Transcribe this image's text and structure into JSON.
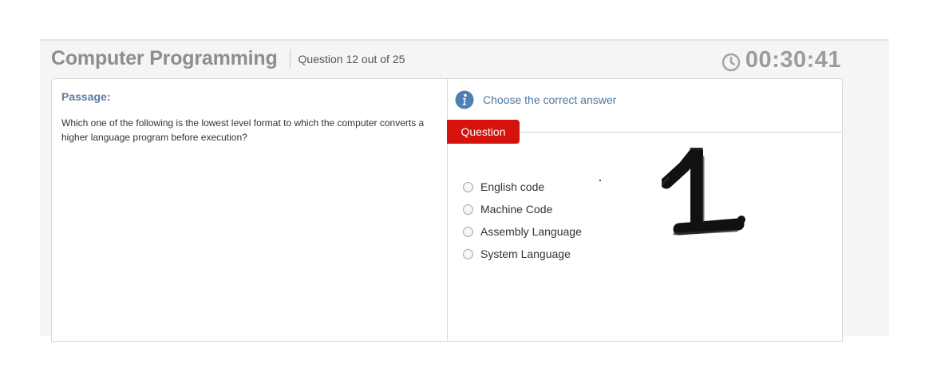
{
  "header": {
    "title": "Computer Programming",
    "question_counter": "Question 12 out of 25",
    "timer": "00:30:41",
    "timer_icon": "clock-icon"
  },
  "passage": {
    "label": "Passage:",
    "text": "Which one of the following is the lowest level format to which the computer converts a higher language program before execution?"
  },
  "question": {
    "instruction": "Choose the correct answer",
    "instruction_icon": "info-icon",
    "tab_label": "Question",
    "options": [
      {
        "label": "English code",
        "selected": false
      },
      {
        "label": "Machine Code",
        "selected": false
      },
      {
        "label": "Assembly Language",
        "selected": false
      },
      {
        "label": "System Language",
        "selected": false
      }
    ],
    "handwritten_mark": "1"
  },
  "colors": {
    "title_gray": "#8c8e91",
    "accent_blue": "#4c77a5",
    "passage_label_blue": "#5b7ea2",
    "question_tab_red": "#d4130f"
  }
}
